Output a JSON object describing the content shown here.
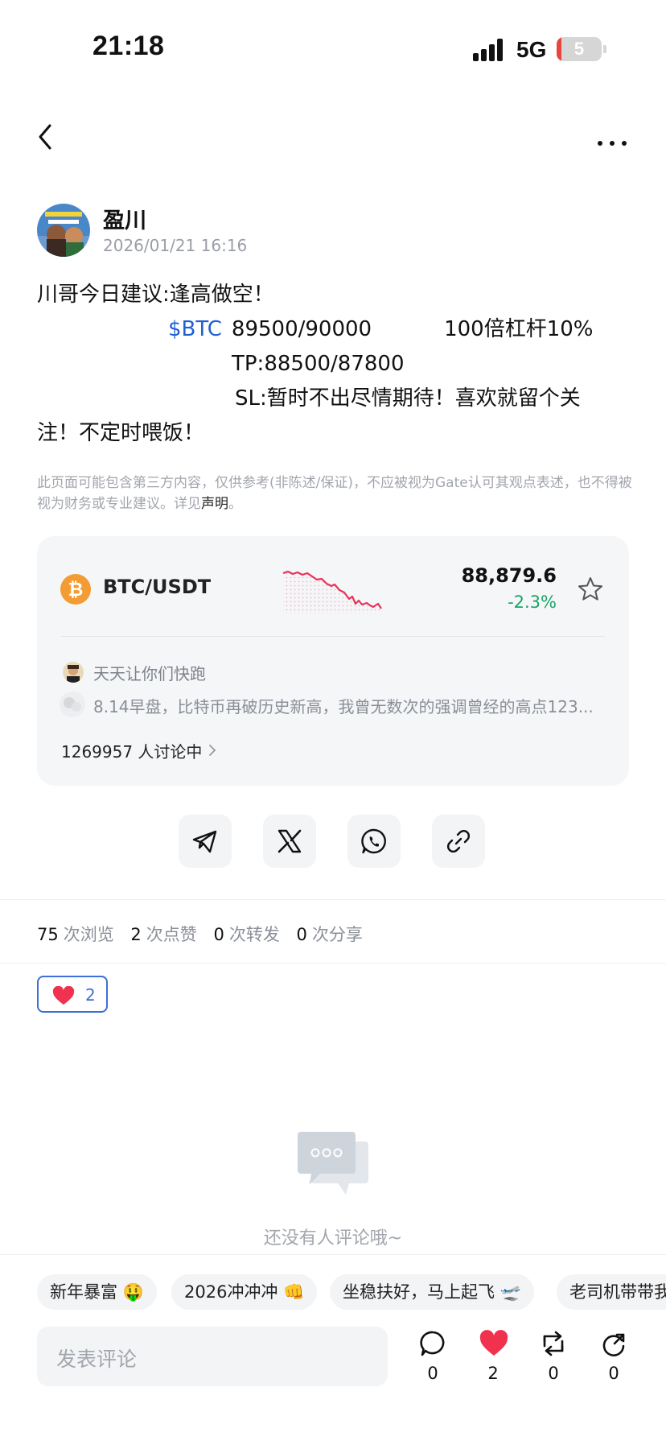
{
  "status_bar": {
    "time": "21:18",
    "network": "5G",
    "battery": "5",
    "battery_level": 0.1
  },
  "post": {
    "author": "盈川",
    "time": "2026/01/21 16:16",
    "lines": {
      "l1": "川哥今日建议:逢高做空！",
      "l2_ticker": "$BTC",
      "l2_entry": "89500/90000",
      "l2_lev": "100倍杠杆10%",
      "l3": "TP:88500/87800",
      "l4": "SL:暂时不出尽情期待！喜欢就留个关",
      "l5": "注！不定时喂饭！"
    },
    "disclaimer": "此页面可能包含第三方内容，仅供参考(非陈述/保证)，不应被视为Gate认可其观点表述，也不得被视为财务或专业建议。详见",
    "disclaimer_link": "声明",
    "disclaimer_end": "。"
  },
  "market_card": {
    "pair": "BTC/USDT",
    "price": "88,879.6",
    "change": "-2.3%",
    "related_user": "天天让你们快跑",
    "related_text": "8.14早盘，比特币再破历史新高，我曾无数次的强调曾经的高点123...",
    "discussing": "1269957 人讨论中",
    "colors": {
      "down": "#e8325a",
      "change": "#17a567"
    }
  },
  "share": {
    "icons": [
      "telegram-icon",
      "x-icon",
      "whatsapp-icon",
      "link-icon"
    ]
  },
  "stats": {
    "views_num": "75",
    "views_label": "次浏览",
    "likes_num": "2",
    "likes_label": "次点赞",
    "reposts_num": "0",
    "reposts_label": "次转发",
    "shares_num": "0",
    "shares_label": "次分享"
  },
  "reaction": {
    "count": "2"
  },
  "comments": {
    "empty": "还没有人评论哦~"
  },
  "tags": [
    "新年暴富 🤑",
    "2026冲冲冲 👊",
    "坐稳扶好，马上起飞 🛫",
    "老司机带带我"
  ],
  "bottom_bar": {
    "placeholder": "发表评论",
    "comment_count": "0",
    "like_count": "2",
    "repost_count": "0",
    "share_count": "0"
  }
}
